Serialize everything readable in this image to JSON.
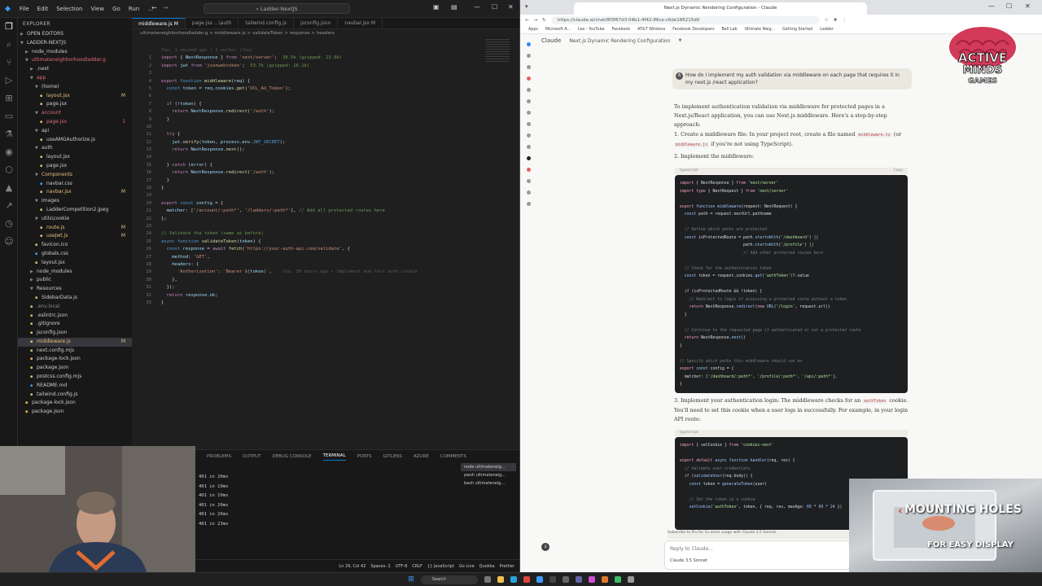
{
  "vscode": {
    "menu": [
      "File",
      "Edit",
      "Selection",
      "View",
      "Go",
      "Run",
      "..."
    ],
    "search": "Ladder-NextJS",
    "explorer_title": "EXPLORER",
    "open_editors": "OPEN EDITORS",
    "workspace": "LADDER-NEXTJS",
    "tree": [
      {
        "label": "node_modules",
        "kind": "folder",
        "indent": 1,
        "open": false,
        "color": "#ccc",
        "marker": ""
      },
      {
        "label": "ultimateneighborhoodladder.g",
        "kind": "folder",
        "indent": 1,
        "open": true,
        "color": "#e06c75",
        "marker": ""
      },
      {
        "label": ".next",
        "kind": "folder",
        "indent": 2,
        "open": false,
        "color": "#ccc",
        "marker": ""
      },
      {
        "label": "app",
        "kind": "folder",
        "indent": 2,
        "open": true,
        "color": "#e06c75",
        "marker": ""
      },
      {
        "label": "(home)",
        "kind": "folder",
        "indent": 3,
        "open": true,
        "color": "#ccc",
        "marker": ""
      },
      {
        "label": "layout.jsx",
        "kind": "file",
        "indent": 4,
        "open": false,
        "color": "#e5c07b",
        "marker": "M"
      },
      {
        "label": "page.jsx",
        "kind": "file",
        "indent": 4,
        "open": false,
        "color": "#ccc",
        "marker": ""
      },
      {
        "label": "account",
        "kind": "folder",
        "indent": 3,
        "open": true,
        "color": "#e06c75",
        "marker": ""
      },
      {
        "label": "page.jsx",
        "kind": "file",
        "indent": 4,
        "open": false,
        "color": "#e06c75",
        "marker": "1"
      },
      {
        "label": "api",
        "kind": "folder",
        "indent": 3,
        "open": true,
        "color": "#ccc",
        "marker": ""
      },
      {
        "label": "useAMGAuthorize.js",
        "kind": "file",
        "indent": 4,
        "open": false,
        "color": "#ccc",
        "marker": ""
      },
      {
        "label": "auth",
        "kind": "folder",
        "indent": 3,
        "open": true,
        "color": "#ccc",
        "marker": ""
      },
      {
        "label": "layout.jsx",
        "kind": "file",
        "indent": 4,
        "open": false,
        "color": "#ccc",
        "marker": ""
      },
      {
        "label": "page.jsx",
        "kind": "file",
        "indent": 4,
        "open": false,
        "color": "#ccc",
        "marker": ""
      },
      {
        "label": "Components",
        "kind": "folder",
        "indent": 3,
        "open": true,
        "color": "#e5c07b",
        "marker": ""
      },
      {
        "label": "navbar.css",
        "kind": "file",
        "indent": 4,
        "open": false,
        "color": "#ccc",
        "marker": ""
      },
      {
        "label": "navbar.jsx",
        "kind": "file",
        "indent": 4,
        "open": false,
        "color": "#e5c07b",
        "marker": "M"
      },
      {
        "label": "images",
        "kind": "folder",
        "indent": 3,
        "open": true,
        "color": "#ccc",
        "marker": ""
      },
      {
        "label": "LadderCompetition2.jpeg",
        "kind": "file",
        "indent": 4,
        "open": false,
        "color": "#ccc",
        "marker": ""
      },
      {
        "label": "utils\\cookie",
        "kind": "folder",
        "indent": 3,
        "open": true,
        "color": "#ccc",
        "marker": ""
      },
      {
        "label": "route.js",
        "kind": "file",
        "indent": 4,
        "open": false,
        "color": "#e5c07b",
        "marker": "M"
      },
      {
        "label": "useJwt.js",
        "kind": "file",
        "indent": 4,
        "open": false,
        "color": "#e5c07b",
        "marker": "M"
      },
      {
        "label": "favicon.ico",
        "kind": "file",
        "indent": 3,
        "open": false,
        "color": "#ccc",
        "marker": ""
      },
      {
        "label": "globals.css",
        "kind": "file",
        "indent": 3,
        "open": false,
        "color": "#ccc",
        "marker": ""
      },
      {
        "label": "layout.jsx",
        "kind": "file",
        "indent": 3,
        "open": false,
        "color": "#ccc",
        "marker": ""
      },
      {
        "label": "node_modules",
        "kind": "folder",
        "indent": 2,
        "open": false,
        "color": "#ccc",
        "marker": ""
      },
      {
        "label": "public",
        "kind": "folder",
        "indent": 2,
        "open": false,
        "color": "#ccc",
        "marker": ""
      },
      {
        "label": "Resources",
        "kind": "folder",
        "indent": 2,
        "open": true,
        "color": "#ccc",
        "marker": ""
      },
      {
        "label": "SidebarData.js",
        "kind": "file",
        "indent": 3,
        "open": false,
        "color": "#ccc",
        "marker": ""
      },
      {
        "label": ".env.local",
        "kind": "file",
        "indent": 2,
        "open": false,
        "color": "#888",
        "marker": ""
      },
      {
        "label": ".eslintrc.json",
        "kind": "file",
        "indent": 2,
        "open": false,
        "color": "#ccc",
        "marker": ""
      },
      {
        "label": ".gitignore",
        "kind": "file",
        "indent": 2,
        "open": false,
        "color": "#ccc",
        "marker": ""
      },
      {
        "label": "jsconfig.json",
        "kind": "file",
        "indent": 2,
        "open": false,
        "color": "#ccc",
        "marker": ""
      },
      {
        "label": "middleware.js",
        "kind": "file",
        "indent": 2,
        "open": false,
        "color": "#e5c07b",
        "marker": "M",
        "selected": true
      },
      {
        "label": "next.config.mjs",
        "kind": "file",
        "indent": 2,
        "open": false,
        "color": "#ccc",
        "marker": ""
      },
      {
        "label": "package-lock.json",
        "kind": "file",
        "indent": 2,
        "open": false,
        "color": "#ccc",
        "marker": ""
      },
      {
        "label": "package.json",
        "kind": "file",
        "indent": 2,
        "open": false,
        "color": "#ccc",
        "marker": ""
      },
      {
        "label": "postcss.config.mjs",
        "kind": "file",
        "indent": 2,
        "open": false,
        "color": "#ccc",
        "marker": ""
      },
      {
        "label": "README.md",
        "kind": "file",
        "indent": 2,
        "open": false,
        "color": "#ccc",
        "marker": ""
      },
      {
        "label": "tailwind.config.js",
        "kind": "file",
        "indent": 2,
        "open": false,
        "color": "#ccc",
        "marker": ""
      },
      {
        "label": "package-lock.json",
        "kind": "file",
        "indent": 1,
        "open": false,
        "color": "#ccc",
        "marker": ""
      },
      {
        "label": "package.json",
        "kind": "file",
        "indent": 1,
        "open": false,
        "color": "#ccc",
        "marker": ""
      }
    ],
    "tabs": [
      {
        "label": "middleware.js M",
        "active": true
      },
      {
        "label": "page.jsx ...\\auth",
        "active": false
      },
      {
        "label": "tailwind.config.js",
        "active": false
      },
      {
        "label": "jsconfig.json",
        "active": false
      },
      {
        "label": "navbar.jsx M",
        "active": false
      }
    ],
    "breadcrumb": "ultimateneighborhoodladder.g > middleware.js > validateToken > response > headers",
    "code_lines": [
      {
        "n": "",
        "html": "<span class='gh'>You, 1 second ago | 1 author (You)</span>"
      },
      {
        "n": "1",
        "html": "<span class='kw'>import</span> <span class='pl'>{ </span><span class='vr'>NextResponse</span><span class='pl'> } </span><span class='kw'>from</span> <span class='st'>'next/server'</span><span class='pl'>;</span>  <span class='cm'>38.5k (gzipped: 13.9k)</span>"
      },
      {
        "n": "2",
        "html": "<span class='kw'>import</span> <span class='vr'>jwt</span> <span class='kw'>from</span> <span class='st'>'jsonwebtoken'</span><span class='pl'>;</span>  <span class='cm'>53.7k (gzipped: 16.1k)</span>"
      },
      {
        "n": "3",
        "html": ""
      },
      {
        "n": "4",
        "html": "<span class='kw'>export</span> <span class='kb'>function</span> <span class='fn'>middleware</span><span class='pl'>(</span><span class='vr'>req</span><span class='pl'>) {</span>"
      },
      {
        "n": "5",
        "html": "  <span class='kb'>const</span> <span class='vr'>token</span> <span class='pl'>= </span><span class='vr'>req</span><span class='pl'>.</span><span class='vr'>cookies</span><span class='pl'>.</span><span class='fn'>get</span><span class='pl'>(</span><span class='st'>'UCL_AU_Token'</span><span class='pl'>);</span>"
      },
      {
        "n": "6",
        "html": ""
      },
      {
        "n": "7",
        "html": "  <span class='kw'>if</span> <span class='pl'>(!</span><span class='vr'>token</span><span class='pl'>) {</span>"
      },
      {
        "n": "8",
        "html": "    <span class='kw'>return</span> <span class='vr'>NextResponse</span><span class='pl'>.</span><span class='fn'>redirect</span><span class='pl'>(</span><span class='st'>'/auth'</span><span class='pl'>);</span>"
      },
      {
        "n": "9",
        "html": "  <span class='pl'>}</span>"
      },
      {
        "n": "10",
        "html": ""
      },
      {
        "n": "11",
        "html": "  <span class='kw'>try</span> <span class='pl'>{</span>"
      },
      {
        "n": "12",
        "html": "    <span class='vr'>jwt</span><span class='pl'>.</span><span class='fn'>verify</span><span class='pl'>(</span><span class='vr'>token</span><span class='pl'>, </span><span class='vr'>process</span><span class='pl'>.</span><span class='vr'>env</span><span class='pl'>.</span><span class='kb'>JWT_SECRET</span><span class='pl'>);</span>"
      },
      {
        "n": "13",
        "html": "    <span class='kw'>return</span> <span class='vr'>NextResponse</span><span class='pl'>.</span><span class='fn'>next</span><span class='pl'>();</span>"
      },
      {
        "n": "14",
        "html": ""
      },
      {
        "n": "15",
        "html": "  <span class='pl'>} </span><span class='kw'>catch</span> <span class='pl'>(</span><span class='vr'>error</span><span class='pl'>) {</span>"
      },
      {
        "n": "16",
        "html": "    <span class='kw'>return</span> <span class='vr'>NextResponse</span><span class='pl'>.</span><span class='fn'>redirect</span><span class='pl'>(</span><span class='st'>'/auth'</span><span class='pl'>);</span>"
      },
      {
        "n": "17",
        "html": "  <span class='pl'>}</span>"
      },
      {
        "n": "18",
        "html": "<span class='pl'>}</span>"
      },
      {
        "n": "19",
        "html": ""
      },
      {
        "n": "20",
        "html": "<span class='kw'>export</span> <span class='kb'>const</span> <span class='vr'>config</span> <span class='pl'>= {</span>"
      },
      {
        "n": "21",
        "html": "  <span class='vr'>matcher</span><span class='pl'>: [</span><span class='st'>'/account/:path*'</span><span class='pl'>, </span><span class='st'>'/ladders/:path*'</span><span class='pl'>], </span><span class='cm'>// Add all protected routes here</span>"
      },
      {
        "n": "22",
        "html": "<span class='pl'>};</span>"
      },
      {
        "n": "23",
        "html": ""
      },
      {
        "n": "24",
        "html": "<span class='cm'>// Validate the token (same as before)</span>"
      },
      {
        "n": "25",
        "html": "<span class='kb'>async</span> <span class='kb'>function</span> <span class='fn'>validateToken</span><span class='pl'>(</span><span class='vr'>token</span><span class='pl'>) {</span>"
      },
      {
        "n": "26",
        "html": "  <span class='kb'>const</span> <span class='vr'>response</span> <span class='pl'>= </span><span class='kw'>await</span> <span class='fn'>fetch</span><span class='pl'>(</span><span class='st'>'https://your-auth-api.com/validate'</span><span class='pl'>, {</span>"
      },
      {
        "n": "27",
        "html": "    <span class='vr'>method</span><span class='pl'>: </span><span class='st'>'GET'</span><span class='pl'>,</span>"
      },
      {
        "n": "28",
        "html": "    <span class='vr'>headers</span><span class='pl'>: {</span>"
      },
      {
        "n": "29",
        "html": "      <span class='st'>'Authorization'</span><span class='pl'>: </span><span class='st'>`Bearer ${</span><span class='vr'>token</span><span class='st'>}`</span><span class='pl'>,</span>    <span class='gh'>You, 38 hours ago • Implement and test auth cookie</span>"
      },
      {
        "n": "30",
        "html": "    <span class='pl'>},</span>"
      },
      {
        "n": "31",
        "html": "  <span class='pl'>});</span>"
      },
      {
        "n": "32",
        "html": "  <span class='kw'>return</span> <span class='vr'>response</span><span class='pl'>.</span><span class='vr'>ok</span><span class='pl'>;</span>"
      },
      {
        "n": "33",
        "html": "<span class='pl'>}</span>"
      }
    ],
    "panel_tabs": [
      "PROBLEMS",
      "OUTPUT",
      "DEBUG CONSOLE",
      "TERMINAL",
      "PORTS",
      "GITLENS",
      "AZURE",
      "COMMENTS"
    ],
    "terminal_lines": [
      "401 in 20ms",
      "401 in 19ms",
      "401 in 19ms",
      "401 in 20ms",
      "401 in 26ms",
      "401 in 23ms"
    ],
    "terminals": [
      "node  ultimateneig...",
      "pwsh  ultimateneig...",
      "bash  ultimateneig..."
    ],
    "status": [
      "Ln 29, Col 42",
      "Spaces: 2",
      "UTF-8",
      "CRLF",
      "{} JavaScript",
      "Go Live",
      "Quokka",
      "Prettier"
    ]
  },
  "browser": {
    "tab_title": "Next.js Dynamic Rendering Configuration - Claude",
    "url": "https://claude.ai/chat/8f3f67d3-04b1-4f42-86ce-c6de186215d0",
    "bookmarks": [
      "Apps",
      "Microsoft A...",
      "Lex - YouTube",
      "Facebook",
      "AT&T Wireless",
      "Facebook Developers",
      "Bell Lab",
      "Ultimate Neig...",
      "Getting Started",
      "Ladder"
    ],
    "claude_label": "Claude",
    "project_title": "Next.js Dynamic Rendering Configuration",
    "user_avatar": "A",
    "user_question": "How do I implement my auth validation via middleware on each page that requires it in my next.js /react application?",
    "intro": "To implement authentication validation via middleware for protected pages in a Next.js/React application, you can use Next.js middleware. Here's a step-by-step approach:",
    "step1_a": "1. Create a middleware file: In your project root, create a file named",
    "step1_file": "middleware.ts",
    "step1_b": "(or",
    "step1_file2": "middleware.js",
    "step1_c": "if you're not using TypeScript).",
    "step2": "2. Implement the middleware:",
    "code1_lang": "typescript",
    "code1_copy": "Copy",
    "code1": [
      "<span class='r'>import</span> { NextResponse } <span class='r'>from</span> <span class='s'>'next/server'</span>",
      "<span class='r'>import</span> <span class='r'>type</span> { NextRequest } <span class='r'>from</span> <span class='s'>'next/server'</span>",
      "",
      "<span class='r'>export</span> <span class='b'>function</span> <span class='b'>middleware</span>(request: NextRequest) {",
      "  <span class='b'>const</span> path = request.nextUrl.pathname",
      "",
      "  <span class='c'>// Define which paths are protected</span>",
      "  <span class='b'>const</span> isProtectedRoute = path.<span class='b'>startsWith</span>(<span class='s'>'/dashboard'</span>) ||",
      "                           path.<span class='b'>startsWith</span>(<span class='s'>'/profile'</span>) ||",
      "                           <span class='c'>// Add other protected routes here</span>",
      "",
      "  <span class='c'>// Check for the authentication token</span>",
      "  <span class='b'>const</span> token = request.cookies.<span class='b'>get</span>(<span class='s'>'authToken'</span>)?.value",
      "",
      "  <span class='r'>if</span> (isProtectedRoute &amp;&amp; !token) {",
      "    <span class='c'>// Redirect to login if accessing a protected route without a token</span>",
      "    <span class='r'>return</span> NextResponse.<span class='b'>redirect</span>(<span class='r'>new</span> <span class='b'>URL</span>(<span class='s'>'/login'</span>, request.url))",
      "  }",
      "",
      "  <span class='c'>// Continue to the requested page if authenticated or not a protected route</span>",
      "  <span class='r'>return</span> NextResponse.<span class='b'>next</span>()",
      "}",
      "",
      "<span class='c'>// Specify which paths this middleware should run on</span>",
      "<span class='r'>export</span> <span class='b'>const</span> config = {",
      "  matcher: [<span class='s'>'/dashboard/:path*'</span>, <span class='s'>'/profile/:path*'</span>, <span class='s'>'/api/:path*'</span>],",
      "}"
    ],
    "step3_a": "3. Implement your authentication login: The middleware checks for an",
    "step3_token": "authToken",
    "step3_b": "cookie. You'll need to set this cookie when a user logs in successfully. For example, in your login API route:",
    "code2_lang": "typescript",
    "code2": [
      "<span class='r'>import</span> { setCookie } <span class='r'>from</span> <span class='s'>'cookies-next'</span>",
      "",
      "<span class='r'>export</span> <span class='r'>default</span> <span class='b'>async</span> <span class='b'>function</span> <span class='b'>handler</span>(req, res) {",
      "  <span class='c'>// Validate user credentials</span>",
      "  <span class='r'>if</span> (<span class='b'>validateUser</span>(req.body)) {",
      "    <span class='b'>const</span> token = <span class='b'>generateToken</span>(user)",
      "",
      "    <span class='c'>// Set the token in a cookie</span>",
      "    <span class='b'>setCookie</span>(<span class='s'>'authToken'</span>, token, { req, res, maxAge: <span class='b'>60</span> * <span class='b'>60</span> * <span class='b'>24</span> })"
    ],
    "notice": "Subscribe to Pro for 5x more usage with Claude 3.5 Sonnet.",
    "reply_placeholder": "Reply to Claude...",
    "model": "Claude 3.5 Sonnet"
  },
  "overlay": {
    "logo_line1": "ACTIVE",
    "logo_line2": "MINDS",
    "logo_line3": "GAMES",
    "promo_line1": "MOUNTING HOLES",
    "promo_line2": "FOR EASY DISPLAY"
  },
  "taskbar": {
    "search": "Search"
  }
}
